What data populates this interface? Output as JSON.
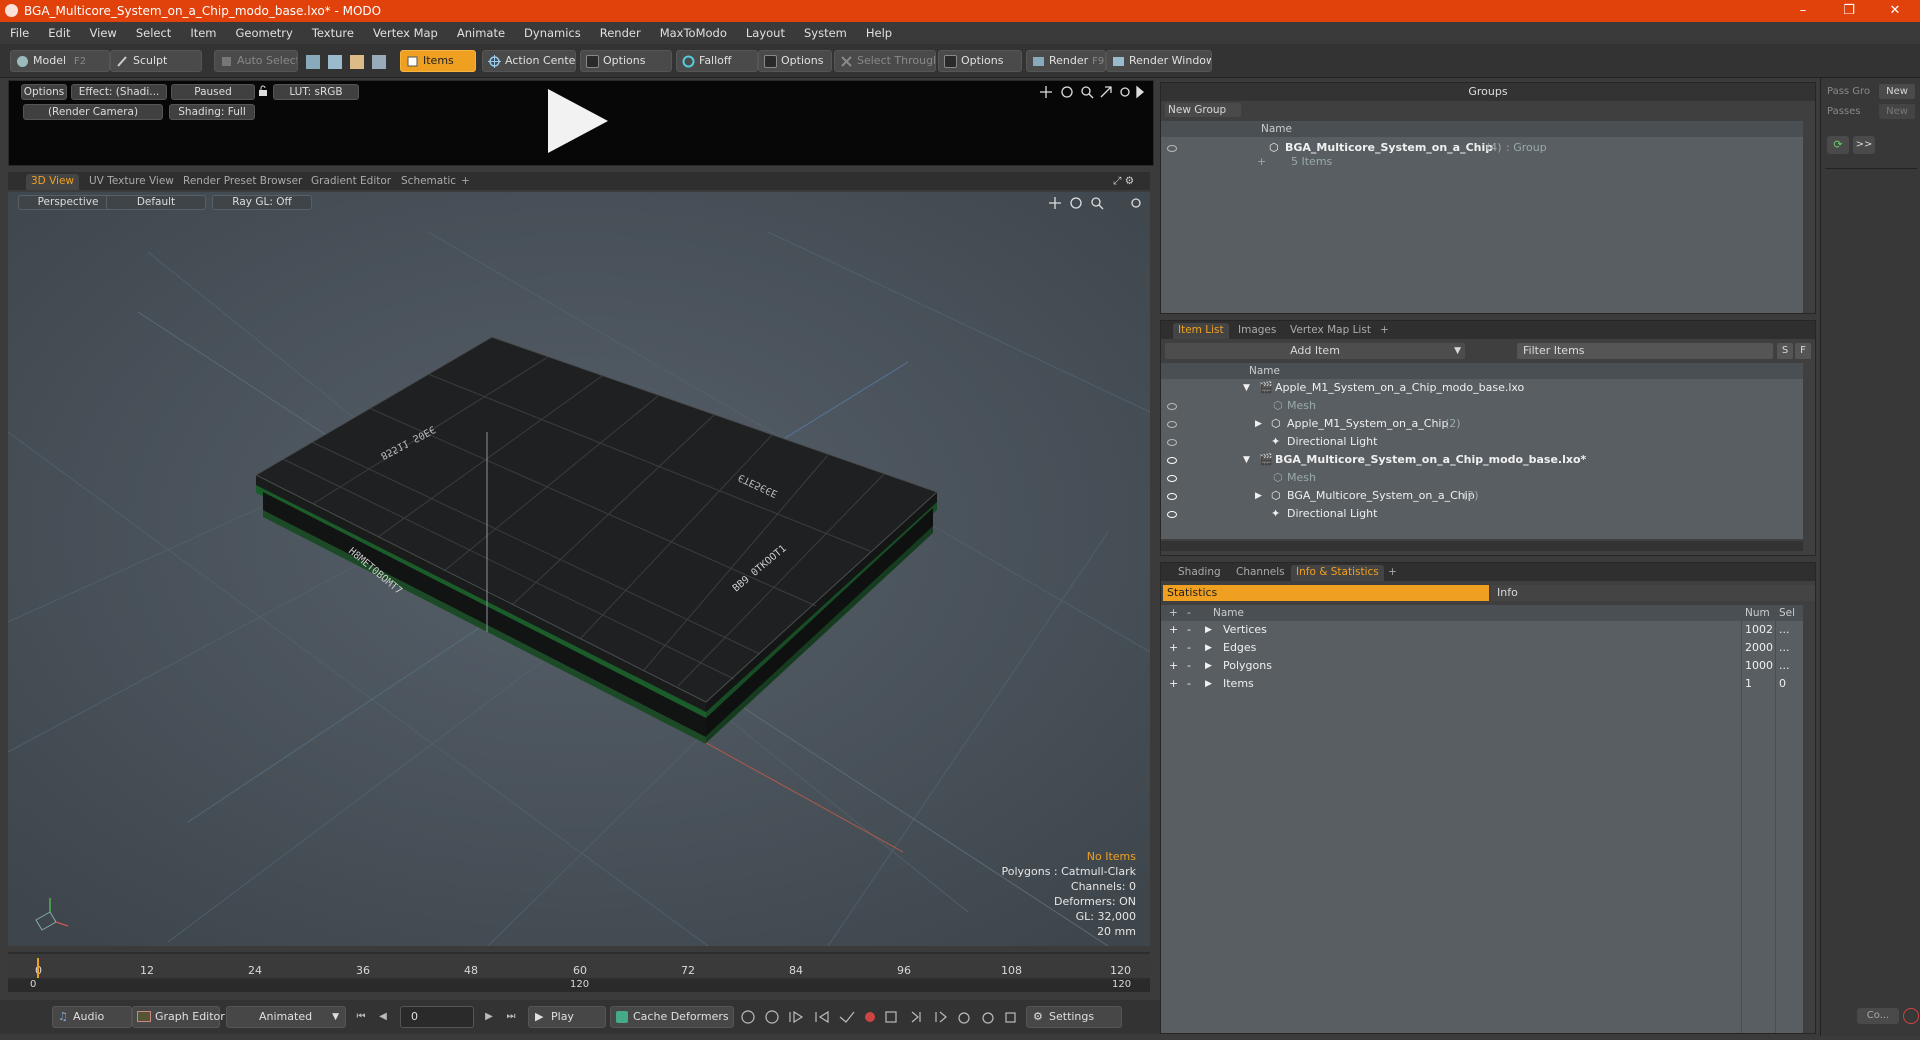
{
  "window": {
    "title": "BGA_Multicore_System_on_a_Chip_modo_base.lxo* - MODO",
    "minimize": "–",
    "maximize": "❐",
    "close": "✕"
  },
  "menu": [
    "File",
    "Edit",
    "View",
    "Select",
    "Item",
    "Geometry",
    "Texture",
    "Vertex Map",
    "Animate",
    "Dynamics",
    "Render",
    "MaxToModo",
    "Layout",
    "System",
    "Help"
  ],
  "toolbar": {
    "model": "Model",
    "model_key": "F2",
    "sculpt": "Sculpt",
    "auto_select": "Auto Select",
    "items": "Items",
    "action_center": "Action Center",
    "options1": "Options",
    "falloff": "Falloff",
    "options2": "Options",
    "select_through": "Select Through",
    "options3": "Options",
    "render": "Render",
    "render_key": "F9",
    "render_window": "Render Window"
  },
  "preview": {
    "options": "Options",
    "effect": "Effect: (Shadi...",
    "paused": "Paused",
    "lut": "LUT: sRGB",
    "camera": "(Render Camera)",
    "shading": "Shading: Full"
  },
  "viewtabs": [
    "3D View",
    "UV Texture View",
    "Render Preset Browser",
    "Gradient Editor",
    "Schematic"
  ],
  "viewport": {
    "perspective": "Perspective",
    "default": "Default",
    "raygl": "Ray GL: Off",
    "hud": {
      "no_items": "No Items",
      "polygons": "Polygons : Catmull-Clark",
      "channels": "Channels: 0",
      "deformers": "Deformers: ON",
      "gl": "GL: 32,000",
      "scale": "20 mm"
    },
    "chip_text": [
      "H8MEТ0ВОМТ7",
      "ВВ9 0ТКООТ1",
      "85511 Ѕ0ЕЄ",
      "ЄТЕ5ЄЄЕ"
    ]
  },
  "timeline": {
    "ticks": [
      "0",
      "12",
      "24",
      "36",
      "48",
      "60",
      "72",
      "84",
      "96",
      "108",
      "120"
    ],
    "range_start": "0",
    "range_mid": "120",
    "range_end": "120"
  },
  "bottombar": {
    "audio": "Audio",
    "graph_editor": "Graph Editor",
    "animated": "Animated",
    "frame": "0",
    "play": "Play",
    "cache_deformers": "Cache Deformers",
    "settings": "Settings"
  },
  "groups": {
    "title": "Groups",
    "new_group": "New Group",
    "col_name": "Name",
    "row_name": "BGA_Multicore_System_on_a_Chip",
    "row_count": "(4)",
    "row_type": ": Group",
    "row_sub": "5 Items"
  },
  "itemlist": {
    "tabs": [
      "Item List",
      "Images",
      "Vertex Map List"
    ],
    "add_item": "Add Item",
    "filter": "Filter Items",
    "s": "S",
    "f": "F",
    "col_name": "Name",
    "rows": [
      {
        "label": "Apple_M1_System_on_a_Chip_modo_base.lxo",
        "extra": ""
      },
      {
        "label": "Mesh",
        "extra": ""
      },
      {
        "label": "Apple_M1_System_on_a_Chip",
        "extra": "(2)"
      },
      {
        "label": "Directional Light",
        "extra": ""
      },
      {
        "label": "BGA_Multicore_System_on_a_Chip_modo_base.lxo*",
        "extra": ""
      },
      {
        "label": "Mesh",
        "extra": ""
      },
      {
        "label": "BGA_Multicore_System_on_a_Chip",
        "extra": "(2)"
      },
      {
        "label": "Directional Light",
        "extra": ""
      }
    ]
  },
  "stats": {
    "tabs": [
      "Shading",
      "Channels",
      "Info & Statistics"
    ],
    "statistics": "Statistics",
    "info": "Info",
    "col_name": "Name",
    "col_num": "Num",
    "col_sel": "Sel",
    "rows": [
      {
        "name": "Vertices",
        "num": "1002",
        "sel": "..."
      },
      {
        "name": "Edges",
        "num": "2000",
        "sel": "..."
      },
      {
        "name": "Polygons",
        "num": "1000",
        "sel": "..."
      },
      {
        "name": "Items",
        "num": "1",
        "sel": "0"
      }
    ]
  },
  "rightstrip": {
    "pass_group": "Pass Gro",
    "new1": "New",
    "passes": "Passes",
    "new2": "New",
    "forward": ">>",
    "co": "Co..."
  },
  "colors": {
    "accent": "#f0a020",
    "title": "#e1420c"
  }
}
